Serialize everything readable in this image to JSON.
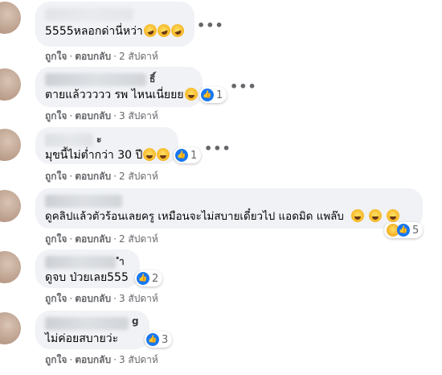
{
  "actions": {
    "like": "ถูกใจ",
    "reply": "ตอบกลับ",
    "separator": "·",
    "more": "•••"
  },
  "comments": [
    {
      "author_tail": "",
      "text": "5555หลอกด่านี่หว่า",
      "emojis": [
        "rofl",
        "rofl",
        "rofl"
      ],
      "reaction_count": "",
      "time": "2 สัปดาห์"
    },
    {
      "author_tail": "ธิ์",
      "text": "ตายแล้ววววว รพ ไหนเนี่ยยย",
      "emojis": [
        "smile"
      ],
      "reaction_count": "1",
      "time": "3 สัปดาห์"
    },
    {
      "author_tail": "ะ",
      "text": "มุขนี้ไม่ต่ำกว่า 30 ปี",
      "emojis": [
        "joy",
        "joy"
      ],
      "reaction_count": "1",
      "time": "2 สัปดาห์"
    },
    {
      "author_tail": "",
      "text": "ดูคลิปแล้วตัวร้อนเลยครู เหมือนจะไม่สบายเดี๋ยวไป แอดมิด แพล๊บ",
      "emojis": [
        "blush",
        "blush",
        "blush"
      ],
      "reaction_count": "5",
      "time": "2 สัปดาห์"
    },
    {
      "author_tail": "ำ",
      "text": "ดูจบ ป่วยเลย555",
      "emojis": [],
      "reaction_count": "2",
      "time": "3 สัปดาห์"
    },
    {
      "author_tail": "g",
      "text": "ไม่ค่อยสบายว่ะ",
      "emojis": [],
      "reaction_count": "3",
      "time": "3 สัปดาห์"
    }
  ]
}
